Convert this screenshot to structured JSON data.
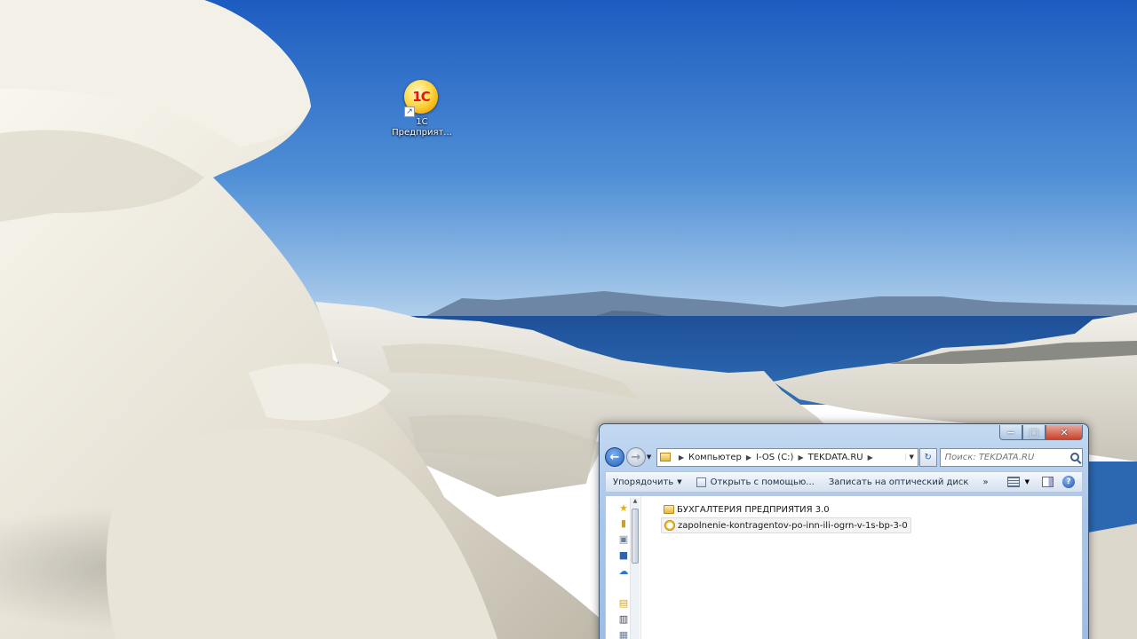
{
  "desktop": {
    "icon": {
      "name": "1c-enterprise",
      "logo_text": "1С",
      "label_line1": "1С",
      "label_line2": "Предприят..."
    }
  },
  "explorer": {
    "controls": {
      "minimize": "−",
      "maximize": "□",
      "close": "✕"
    },
    "address": {
      "crumbs": [
        "Компьютер",
        "I-OS (C:)",
        "TEKDATA.RU"
      ]
    },
    "search": {
      "placeholder": "Поиск: TEKDATA.RU"
    },
    "toolbar": {
      "organize": "Упорядочить",
      "open_with": "Открыть с помощью...",
      "burn": "Записать на оптический диск",
      "more": "»",
      "help": "?"
    },
    "files": [
      {
        "name": "БУХГАЛТЕРИЯ ПРЕДПРИЯТИЯ 3.0",
        "type": "folder",
        "selected": false
      },
      {
        "name": "zapolnenie-kontragentov-po-inn-ili-ogrn-v-1s-bp-3-0",
        "type": "video",
        "selected": true
      }
    ]
  },
  "colors": {
    "sky_top": "#1f5fbf",
    "sky_horizon": "#a9cbe8",
    "sea": "#2a63a8",
    "rock": "#e9e5d9",
    "window_frame": "#a9c6ea"
  }
}
